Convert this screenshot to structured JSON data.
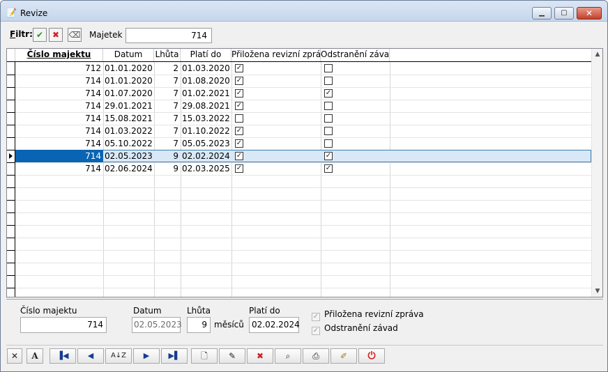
{
  "window": {
    "title": "Revize"
  },
  "filter": {
    "label_prefix": "F",
    "label_rest": "iltr:",
    "majetek_label": "Majetek",
    "majetek_value": "714"
  },
  "columns": {
    "cislo": "Číslo majektu",
    "datum": "Datum",
    "lhuta": "Lhůta",
    "plati": "Platí do",
    "zprava": "Přiložena revizní zpráva",
    "zavady": "Odstranění závad"
  },
  "rows": [
    {
      "cislo": "712",
      "datum": "01.01.2020",
      "lhuta": "2",
      "plati": "01.03.2020",
      "zprava": true,
      "zavady": false
    },
    {
      "cislo": "714",
      "datum": "01.01.2020",
      "lhuta": "7",
      "plati": "01.08.2020",
      "zprava": true,
      "zavady": false
    },
    {
      "cislo": "714",
      "datum": "01.07.2020",
      "lhuta": "7",
      "plati": "01.02.2021",
      "zprava": true,
      "zavady": true
    },
    {
      "cislo": "714",
      "datum": "29.01.2021",
      "lhuta": "7",
      "plati": "29.08.2021",
      "zprava": true,
      "zavady": false
    },
    {
      "cislo": "714",
      "datum": "15.08.2021",
      "lhuta": "7",
      "plati": "15.03.2022",
      "zprava": false,
      "zavady": false
    },
    {
      "cislo": "714",
      "datum": "01.03.2022",
      "lhuta": "7",
      "plati": "01.10.2022",
      "zprava": true,
      "zavady": false
    },
    {
      "cislo": "714",
      "datum": "05.10.2022",
      "lhuta": "7",
      "plati": "05.05.2023",
      "zprava": true,
      "zavady": false
    },
    {
      "cislo": "714",
      "datum": "02.05.2023",
      "lhuta": "9",
      "plati": "02.02.2024",
      "zprava": true,
      "zavady": true,
      "selected": true
    },
    {
      "cislo": "714",
      "datum": "02.06.2024",
      "lhuta": "9",
      "plati": "02.03.2025",
      "zprava": true,
      "zavady": true
    }
  ],
  "detail": {
    "cislo_label": "Číslo majektu",
    "cislo_value": "714",
    "datum_label": "Datum",
    "datum_value": "02.05.2023",
    "lhuta_label": "Lhůta",
    "lhuta_value": "9",
    "lhuta_unit": "měsíců",
    "plati_label": "Platí do",
    "plati_value": "02.02.2024",
    "zprava_label": "Přiložena revizní zpráva",
    "zavady_label": "Odstranění závad"
  },
  "toolbar_icons": [
    "close-x-icon",
    "font-icon",
    "first-record-icon",
    "prev-record-icon",
    "sort-icon",
    "next-record-icon",
    "last-record-icon",
    "new-document-icon",
    "edit-icon",
    "delete-icon",
    "search-icon",
    "print-icon",
    "wizard-icon",
    "power-icon"
  ],
  "colors": {
    "selection": "#0a64b4",
    "titlebar": "#c6d6ec",
    "close_button": "#c2412b"
  }
}
